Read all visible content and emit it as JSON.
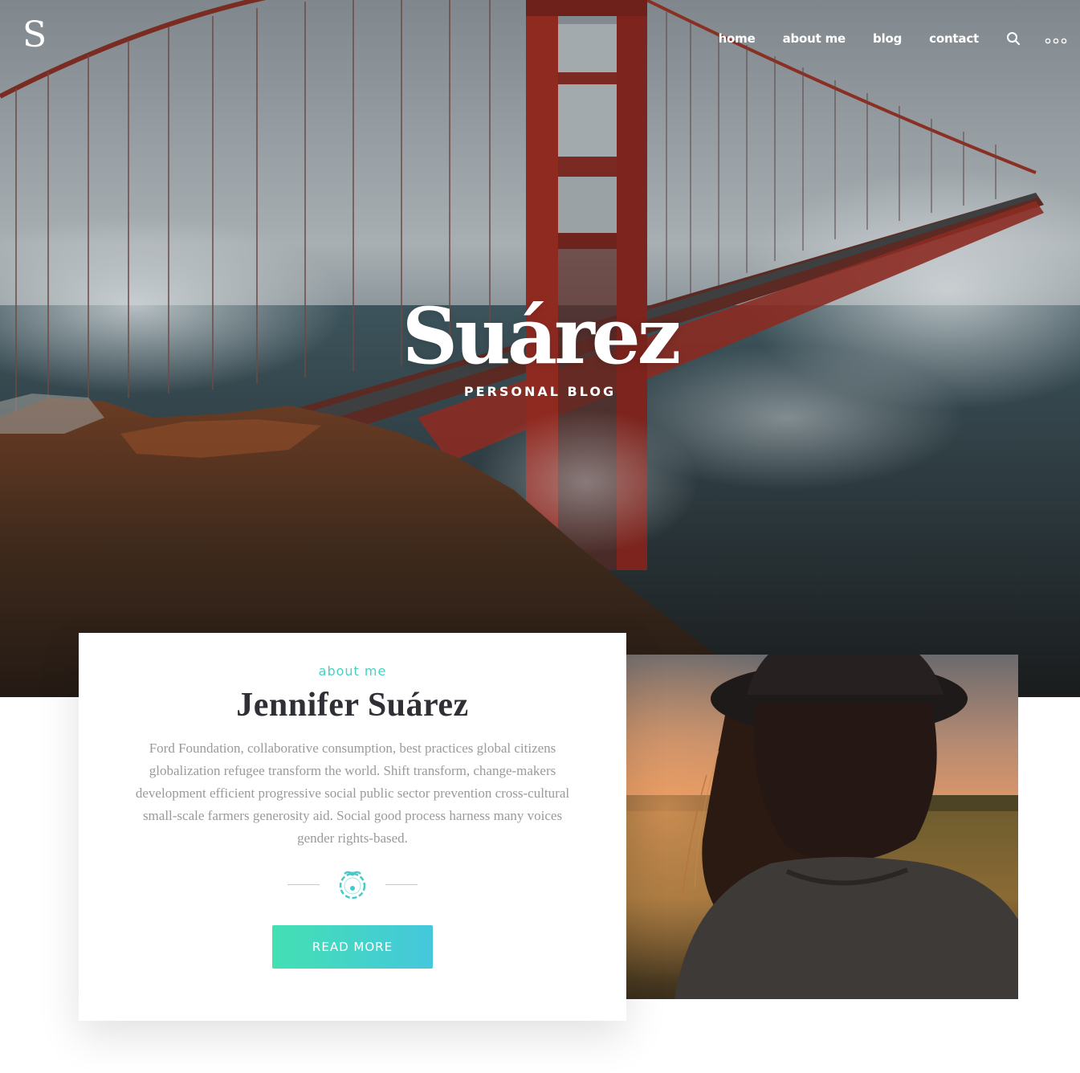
{
  "header": {
    "logo": "S",
    "nav": [
      {
        "label": "home"
      },
      {
        "label": "about me"
      },
      {
        "label": "blog"
      },
      {
        "label": "contact"
      }
    ],
    "icons": {
      "search": "search-icon",
      "more": "more-dots-icon"
    }
  },
  "hero": {
    "title": "Suárez",
    "subtitle": "PERSONAL BLOG"
  },
  "about": {
    "eyebrow": "about me",
    "name": "Jennifer Suárez",
    "text": "Ford Foundation, collaborative consumption, best practices global citizens globalization refugee transform the world. Shift transform, change-makers development efficient progressive social public sector prevention cross-cultural small-scale farmers generosity aid. Social good process harness many voices gender rights-based.",
    "button_label": "READ MORE",
    "divider_icon": "wreath-icon"
  },
  "colors": {
    "accent": "#45d1c4",
    "button_start": "#43e0b3",
    "button_end": "#45c7dc"
  }
}
